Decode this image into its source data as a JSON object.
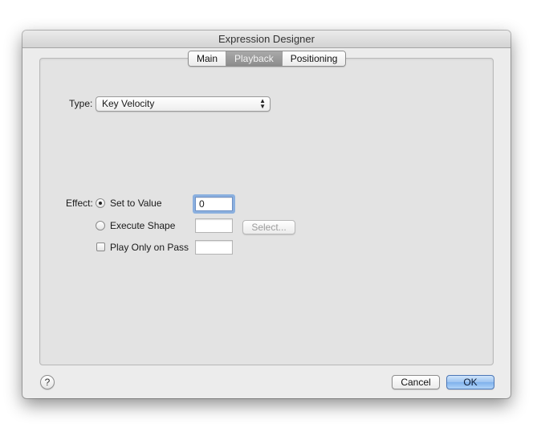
{
  "window": {
    "title": "Expression Designer"
  },
  "tabs": [
    {
      "label": "Main",
      "selected": false
    },
    {
      "label": "Playback",
      "selected": true
    },
    {
      "label": "Positioning",
      "selected": false
    }
  ],
  "type_row": {
    "label": "Type:",
    "selected_value": "Key Velocity"
  },
  "effect": {
    "label": "Effect:",
    "set_to_value": {
      "label": "Set to Value",
      "checked": true,
      "value": "0"
    },
    "execute_shape": {
      "label": "Execute Shape",
      "checked": false,
      "value": "",
      "select_button": "Select..."
    },
    "play_only_on_pass": {
      "label": "Play Only on Pass",
      "checked": false,
      "value": ""
    }
  },
  "footer": {
    "help_label": "?",
    "cancel_label": "Cancel",
    "ok_label": "OK"
  }
}
